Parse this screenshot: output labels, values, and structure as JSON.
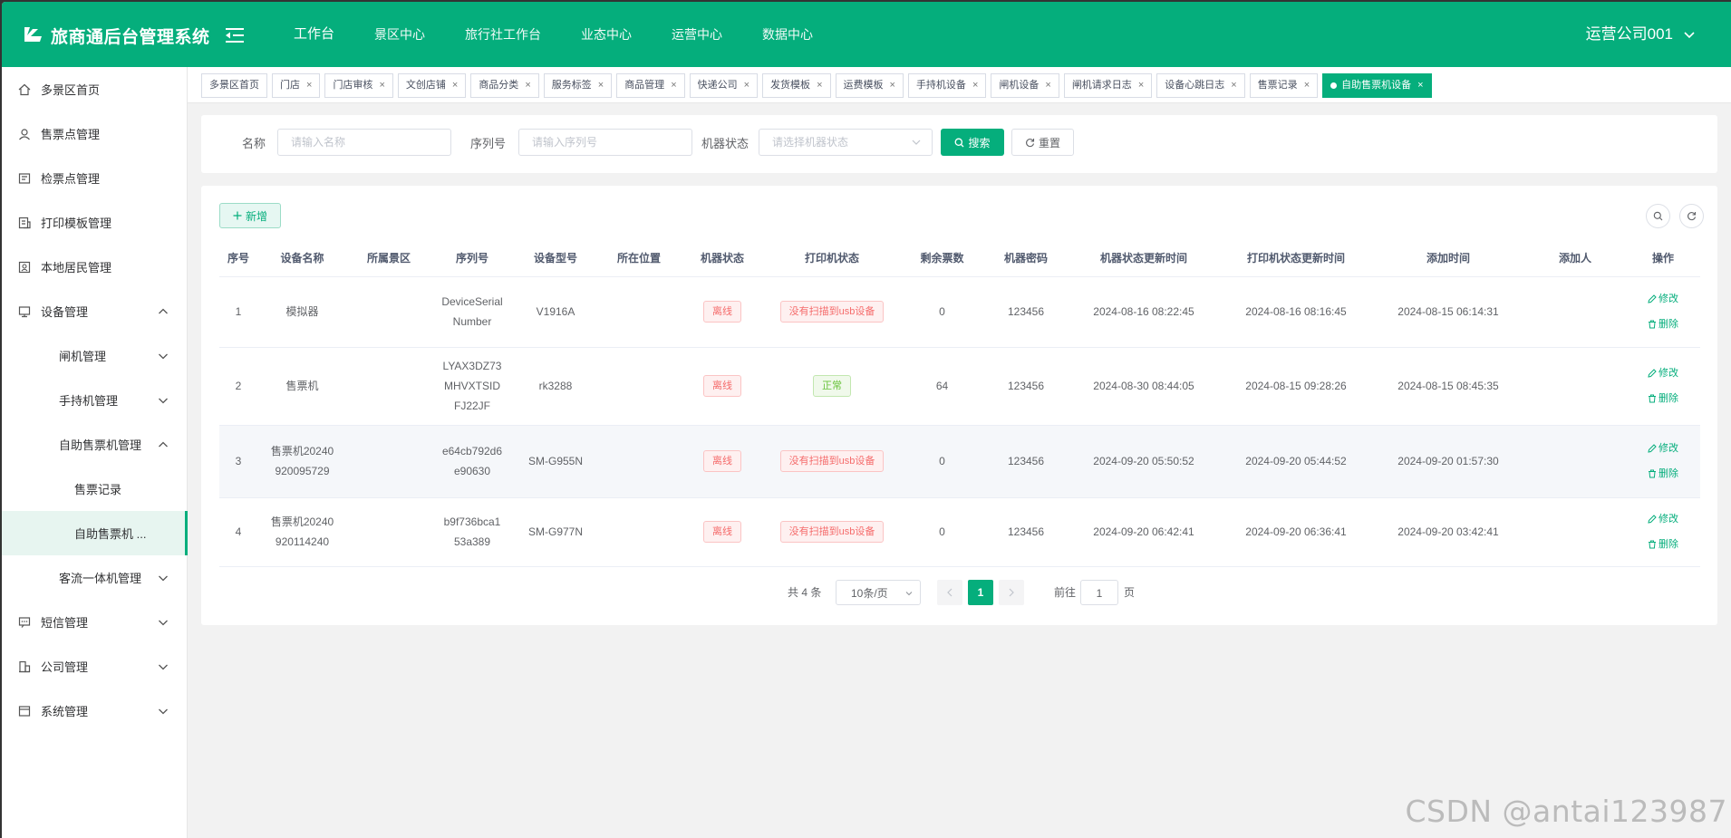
{
  "header": {
    "app_title": "旅商通后台管理系统",
    "nav": [
      "工作台",
      "景区中心",
      "旅行社工作台",
      "业态中心",
      "运营中心",
      "数据中心"
    ],
    "user": "运营公司001"
  },
  "sidebar": {
    "items": [
      {
        "label": "多景区首页",
        "icon": "home-icon"
      },
      {
        "label": "售票点管理",
        "icon": "ticket-point-icon"
      },
      {
        "label": "检票点管理",
        "icon": "check-point-icon"
      },
      {
        "label": "打印模板管理",
        "icon": "print-template-icon"
      },
      {
        "label": "本地居民管理",
        "icon": "resident-icon"
      },
      {
        "label": "设备管理",
        "icon": "device-icon"
      },
      {
        "label": "闸机管理"
      },
      {
        "label": "手持机管理"
      },
      {
        "label": "自助售票机管理"
      },
      {
        "label": "售票记录"
      },
      {
        "label": "自助售票机 ..."
      },
      {
        "label": "客流一体机管理"
      },
      {
        "label": "短信管理",
        "icon": "sms-icon"
      },
      {
        "label": "公司管理",
        "icon": "company-icon"
      },
      {
        "label": "系统管理",
        "icon": "system-icon"
      }
    ]
  },
  "tags": [
    "多景区首页",
    "门店",
    "门店审核",
    "文创店铺",
    "商品分类",
    "服务标签",
    "商品管理",
    "快递公司",
    "发货模板",
    "运费模板",
    "手持机设备",
    "闸机设备",
    "闸机请求日志",
    "设备心跳日志",
    "售票记录",
    "自助售票机设备"
  ],
  "search": {
    "name_label": "名称",
    "name_placeholder": "请输入名称",
    "serial_label": "序列号",
    "serial_placeholder": "请输入序列号",
    "status_label": "机器状态",
    "status_placeholder": "请选择机器状态",
    "search_btn": "搜索",
    "reset_btn": "重置"
  },
  "toolbar": {
    "add_btn": "新增"
  },
  "table": {
    "columns": [
      "序号",
      "设备名称",
      "所属景区",
      "序列号",
      "设备型号",
      "所在位置",
      "机器状态",
      "打印机状态",
      "剩余票数",
      "机器密码",
      "机器状态更新时间",
      "打印机状态更新时间",
      "添加时间",
      "添加人",
      "操作"
    ],
    "rows": [
      {
        "idx": "1",
        "name": [
          "模拟器"
        ],
        "scenic": "",
        "serial": [
          "DeviceSerial",
          "Number"
        ],
        "model": "V1916A",
        "location": "",
        "status": "离线",
        "printer": "没有扫描到usb设备",
        "printer_ok": false,
        "tickets": "0",
        "pwd": "123456",
        "status_time": "2024-08-16 08:22:45",
        "printer_time": "2024-08-16 08:16:45",
        "add_time": "2024-08-15 06:14:31",
        "adder": ""
      },
      {
        "idx": "2",
        "name": [
          "售票机"
        ],
        "scenic": "",
        "serial": [
          "LYAX3DZ73",
          "MHVXTSID",
          "FJ22JF"
        ],
        "model": "rk3288",
        "location": "",
        "status": "离线",
        "printer": "正常",
        "printer_ok": true,
        "tickets": "64",
        "pwd": "123456",
        "status_time": "2024-08-30 08:44:05",
        "printer_time": "2024-08-15 09:28:26",
        "add_time": "2024-08-15 08:45:35",
        "adder": ""
      },
      {
        "idx": "3",
        "name": [
          "售票机20240",
          "920095729"
        ],
        "scenic": "",
        "serial": [
          "e64cb792d6",
          "e90630"
        ],
        "model": "SM-G955N",
        "location": "",
        "status": "离线",
        "printer": "没有扫描到usb设备",
        "printer_ok": false,
        "tickets": "0",
        "pwd": "123456",
        "status_time": "2024-09-20 05:50:52",
        "printer_time": "2024-09-20 05:44:52",
        "add_time": "2024-09-20 01:57:30",
        "adder": ""
      },
      {
        "idx": "4",
        "name": [
          "售票机20240",
          "920114240"
        ],
        "scenic": "",
        "serial": [
          "b9f736bca1",
          "53a389"
        ],
        "model": "SM-G977N",
        "location": "",
        "status": "离线",
        "printer": "没有扫描到usb设备",
        "printer_ok": false,
        "tickets": "0",
        "pwd": "123456",
        "status_time": "2024-09-20 06:42:41",
        "printer_time": "2024-09-20 06:36:41",
        "add_time": "2024-09-20 03:42:41",
        "adder": ""
      }
    ],
    "edit_label": "修改",
    "delete_label": "删除"
  },
  "pagination": {
    "total_text": "共 4 条",
    "page_size": "10条/页",
    "current_page": "1",
    "goto_prefix": "前往",
    "goto_value": "1",
    "goto_suffix": "页"
  },
  "watermark": "CSDN @antai123987",
  "colors": {
    "brand": "#05ae7c",
    "danger": "#f56c6c",
    "success": "#67c23a"
  }
}
